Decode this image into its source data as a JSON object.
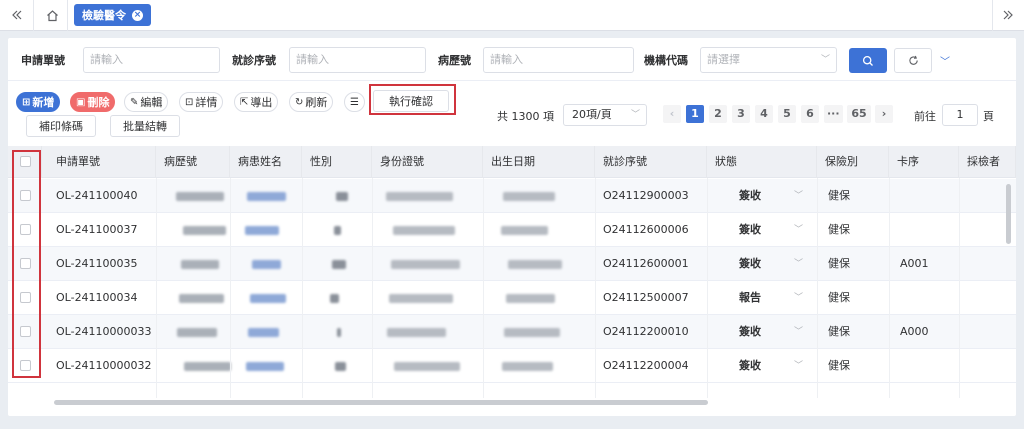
{
  "topbar": {
    "collapse_icon": "double-chevron-left",
    "home_icon": "home",
    "active_tab": "檢驗醫令",
    "expand_icon": "double-chevron-right"
  },
  "search": {
    "fields": [
      {
        "label": "申請單號",
        "placeholder": "請輸入"
      },
      {
        "label": "就診序號",
        "placeholder": "請輸入"
      },
      {
        "label": "病歷號",
        "placeholder": "請輸入"
      },
      {
        "label": "機構代碼",
        "placeholder": "請選擇"
      }
    ]
  },
  "toolbar": {
    "add": "新增",
    "delete": "刪除",
    "edit": "編輯",
    "details": "詳情",
    "export": "導出",
    "refresh": "刷新",
    "confirm": "執行確認",
    "print_barcode": "補印條碼",
    "batch_transfer": "批量結轉"
  },
  "pagination": {
    "total": "共 1300 項",
    "page_size": "20項/頁",
    "pages": [
      "1",
      "2",
      "3",
      "4",
      "5",
      "6",
      "···",
      "65"
    ],
    "current": "1",
    "goto_label": "前往",
    "goto_value": "1",
    "goto_unit": "頁"
  },
  "table": {
    "columns": [
      "申請單號",
      "病歷號",
      "病患姓名",
      "性別",
      "身份證號",
      "出生日期",
      "就診序號",
      "狀態",
      "保險別",
      "卡序",
      "採檢者"
    ],
    "rows": [
      {
        "order_no": "OL-241100040",
        "visit_no": "O24112900003",
        "status": "簽收",
        "insurance": "健保",
        "card": ""
      },
      {
        "order_no": "OL-241100037",
        "visit_no": "O24112600006",
        "status": "簽收",
        "insurance": "健保",
        "card": ""
      },
      {
        "order_no": "OL-241100035",
        "visit_no": "O24112600001",
        "status": "簽收",
        "insurance": "健保",
        "card": "A001"
      },
      {
        "order_no": "OL-241100034",
        "visit_no": "O24112500007",
        "status": "報告",
        "insurance": "健保",
        "card": ""
      },
      {
        "order_no": "OL-24110000033",
        "visit_no": "O24112200010",
        "status": "簽收",
        "insurance": "健保",
        "card": "A000"
      },
      {
        "order_no": "OL-24110000032",
        "visit_no": "O24112200004",
        "status": "簽收",
        "insurance": "健保",
        "card": ""
      }
    ]
  },
  "colors": {
    "primary": "#3d72d6",
    "danger": "#f06b6b",
    "highlight": "#d0343d"
  }
}
